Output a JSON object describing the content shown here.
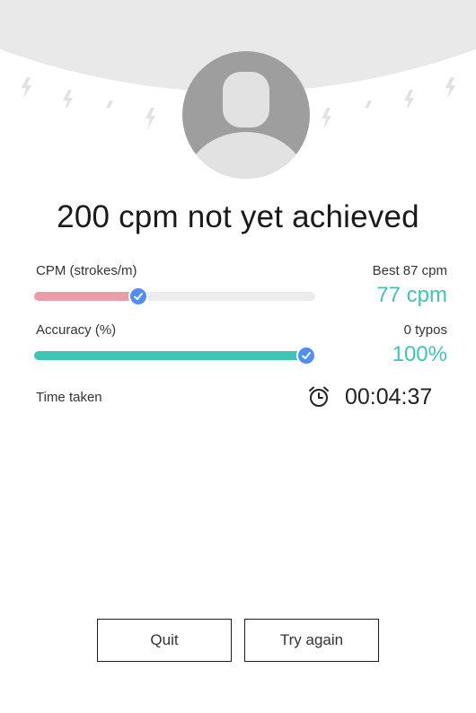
{
  "result": {
    "title": "200 cpm not yet achieved"
  },
  "cpm": {
    "label": "CPM (strokes/m)",
    "best": "Best 87 cpm",
    "value": "77 cpm",
    "fraction": 0.37,
    "fill_color": "#ec9ca8"
  },
  "accuracy": {
    "label": "Accuracy (%)",
    "typos": "0 typos",
    "value": "100%",
    "fraction": 1.0,
    "fill_color": "#3fc4b8"
  },
  "time": {
    "label": "Time taken",
    "value": "00:04:37",
    "icon": "alarm-clock-icon"
  },
  "buttons": {
    "quit": "Quit",
    "try_again": "Try again"
  },
  "colors": {
    "accent": "#3fc4b8",
    "knob": "#4f8ff0",
    "track": "#ececec"
  }
}
